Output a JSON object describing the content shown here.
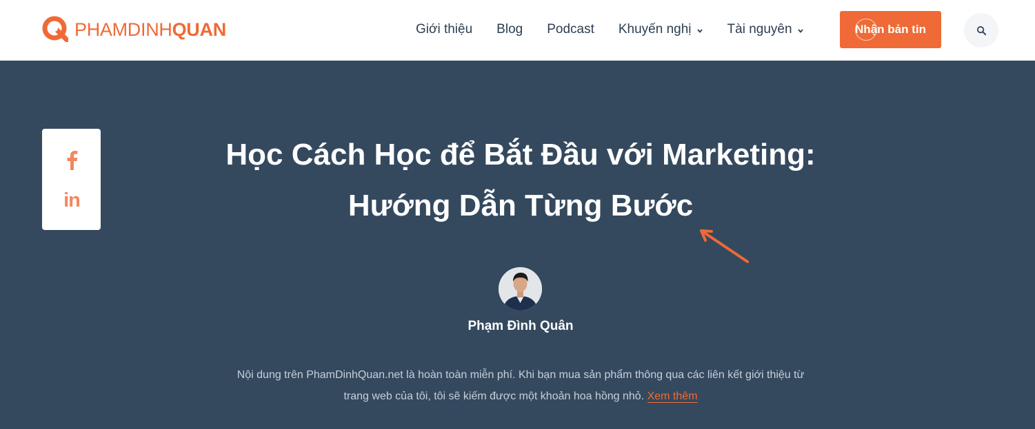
{
  "header": {
    "logo": {
      "text_light": "PHAMDINH",
      "text_bold": "QUAN"
    },
    "nav": [
      {
        "label": "Giới thiệu",
        "has_dropdown": false
      },
      {
        "label": "Blog",
        "has_dropdown": false
      },
      {
        "label": "Podcast",
        "has_dropdown": false
      },
      {
        "label": "Khuyến nghị",
        "has_dropdown": true
      },
      {
        "label": "Tài nguyên",
        "has_dropdown": true
      }
    ],
    "cta_label": "Nhận bản tin",
    "search_icon": "search-icon"
  },
  "share": {
    "icons": [
      "facebook-icon",
      "linkedin-icon"
    ],
    "linkedin_glyph": "in"
  },
  "article": {
    "title_line1": "Học Cách Học để Bắt Đầu với Marketing:",
    "title_line2": "Hướng Dẫn Từng Bước",
    "author": "Phạm Đình Quân",
    "disclaimer_text": "Nội dung trên PhamDinhQuan.net là hoàn toàn miễn phí. Khi bạn mua sản phẩm thông qua các liên kết giới thiệu từ trang web của tôi, tôi sẽ kiếm được một khoản hoa hồng nhỏ.",
    "disclaimer_link": "Xem thêm"
  },
  "colors": {
    "accent": "#ef6a36",
    "hero_bg": "#34495e",
    "header_bg": "#ffffff"
  }
}
